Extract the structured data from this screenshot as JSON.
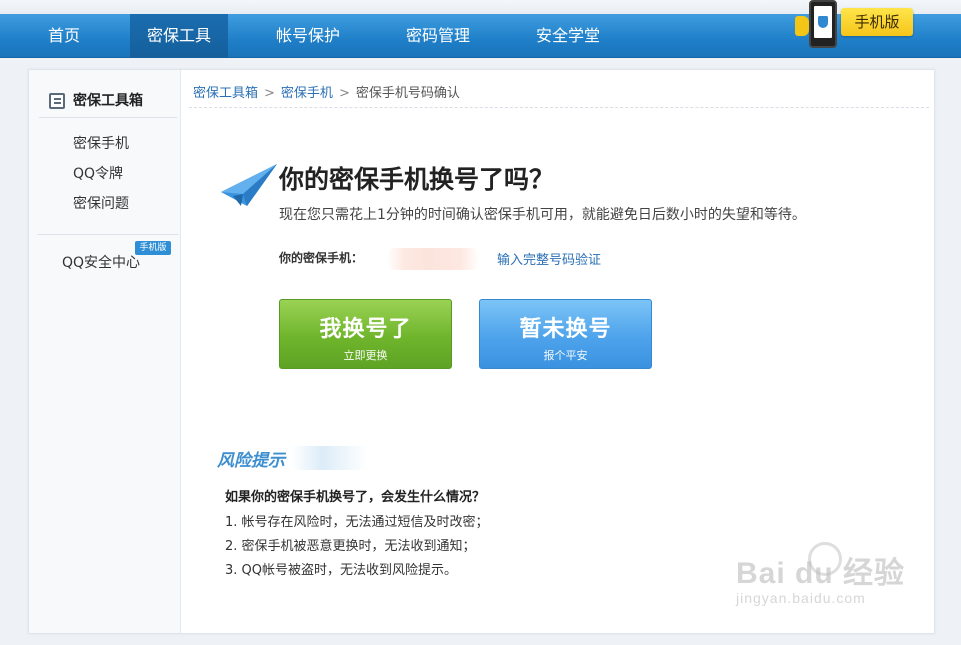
{
  "nav": {
    "items": [
      {
        "label": "首页",
        "active": false
      },
      {
        "label": "密保工具",
        "active": true
      },
      {
        "label": "帐号保护",
        "active": false
      },
      {
        "label": "密码管理",
        "active": false
      },
      {
        "label": "安全学堂",
        "active": false
      }
    ],
    "mobile_badge": "手机版"
  },
  "sidebar": {
    "title": "密保工具箱",
    "links": [
      "密保手机",
      "QQ令牌",
      "密保问题"
    ],
    "security_center": "QQ安全中心",
    "security_center_badge": "手机版"
  },
  "breadcrumb": {
    "items": [
      "密保工具箱",
      "密保手机",
      "密保手机号码确认"
    ]
  },
  "main": {
    "headline": "你的密保手机换号了吗？",
    "subline": "现在您只需花上1分钟的时间确认密保手机可用，就能避免日后数小时的失望和等待。",
    "phone_label": "你的密保手机：",
    "verify_link": "输入完整号码验证",
    "btn_changed": {
      "title": "我换号了",
      "subtitle": "立即更换"
    },
    "btn_not_changed": {
      "title": "暂未换号",
      "subtitle": "报个平安"
    }
  },
  "risk": {
    "title": "风险提示",
    "question": "如果你的密保手机换号了，会发生什么情况？",
    "items": [
      "1. 帐号存在风险时，无法通过短信及时改密；",
      "2. 密保手机被恶意更换时，无法收到通知；",
      "3. QQ帐号被盗时，无法收到风险提示。"
    ]
  },
  "watermark": {
    "logo": "Bai du 经验",
    "sub": "jingyan.baidu.com"
  },
  "colors": {
    "nav_bg": "#2a88d2",
    "green_button": "#6fb52c",
    "blue_button": "#4ea3eb",
    "link": "#2a6fb5"
  }
}
